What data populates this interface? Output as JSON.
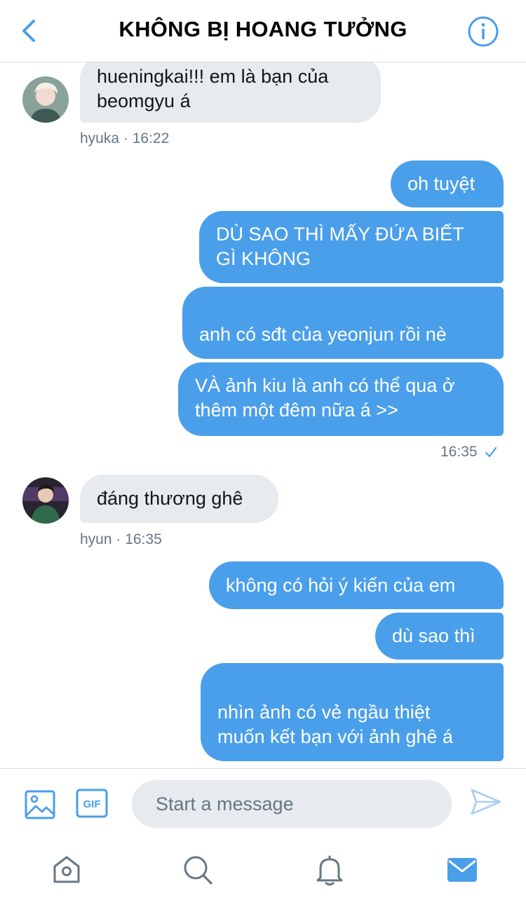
{
  "header": {
    "title": "KHÔNG BỊ HOANG TƯỞNG",
    "back_icon": "chevron-left-icon",
    "info_icon": "info-icon"
  },
  "colors": {
    "accent": "#4a9fea",
    "incoming_bubble": "#e7eaee",
    "meta_text": "#657786"
  },
  "messages": [
    {
      "direction": "incoming",
      "text": "hueningkai!!! em là bạn của\nbeomgyu á"
    },
    {
      "direction": "incoming_meta",
      "text": "hyuka · 16:22"
    },
    {
      "direction": "outgoing",
      "text": "oh tuyệt"
    },
    {
      "direction": "outgoing",
      "text": "DÙ SAO THÌ MẤY ĐỨA BIẾT\nGÌ KHÔNG"
    },
    {
      "direction": "outgoing",
      "text": "anh có sđt của yeonjun rồi nè",
      "emojis": [
        "😎",
        "😎",
        "😎",
        "😎",
        "😎",
        "😎"
      ]
    },
    {
      "direction": "outgoing",
      "text": "VÀ ảnh kiu là anh có thể qua ở\nthêm một đêm nữa á >>"
    },
    {
      "direction": "outgoing_meta",
      "text": "16:35",
      "status_icon": "checkmark-icon"
    },
    {
      "direction": "incoming",
      "text": "đáng thương ghê"
    },
    {
      "direction": "incoming_meta",
      "text": "hyun · 16:35"
    },
    {
      "direction": "outgoing",
      "text": "không có hỏi ý kiến của em"
    },
    {
      "direction": "outgoing",
      "text": "dù sao thì"
    },
    {
      "direction": "outgoing",
      "text": "nhìn ảnh có vẻ ngầu thiệt\nmuốn kết bạn với ảnh ghê á",
      "emojis": [
        "😌",
        "😌",
        "😌"
      ]
    }
  ],
  "compose": {
    "placeholder": "Start a message",
    "image_icon": "image-icon",
    "gif_label": "GIF",
    "send_icon": "send-icon"
  },
  "tabbar": {
    "items": [
      {
        "name": "home-icon"
      },
      {
        "name": "search-icon"
      },
      {
        "name": "notifications-icon"
      },
      {
        "name": "messages-icon",
        "active": true
      }
    ]
  }
}
